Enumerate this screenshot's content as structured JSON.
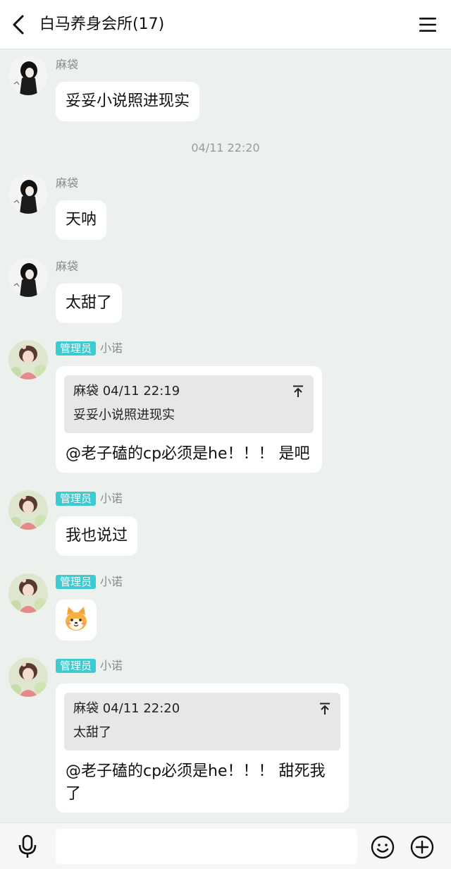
{
  "header": {
    "title": "白马养身会所(17)"
  },
  "messages": [
    {
      "sender": "麻袋",
      "text": "妥妥小说照进现实"
    },
    {
      "sender": "麻袋",
      "text": "天呐"
    },
    {
      "sender": "麻袋",
      "text": "太甜了"
    },
    {
      "badge": "管理员",
      "sender": "小诺",
      "quote_meta": "麻袋 04/11 22:19",
      "quote_text": "妥妥小说照进现实",
      "text": "@老子磕的cp必须是he！！！  是吧"
    },
    {
      "badge": "管理员",
      "sender": "小诺",
      "text": "我也说过"
    },
    {
      "badge": "管理员",
      "sender": "小诺",
      "sticker": "shiba-dog-sticker"
    },
    {
      "badge": "管理员",
      "sender": "小诺",
      "quote_meta": "麻袋 04/11 22:20",
      "quote_text": "太甜了",
      "text": "@老子磕的cp必须是he！！！  甜死我了"
    }
  ],
  "timestamps": [
    "04/11 22:20"
  ],
  "input": {
    "value": "",
    "placeholder": ""
  },
  "colors": {
    "background": "#edf1ed",
    "badge": "#3ccbd1",
    "bubble": "#ffffff",
    "quote": "#e7e7e7"
  }
}
